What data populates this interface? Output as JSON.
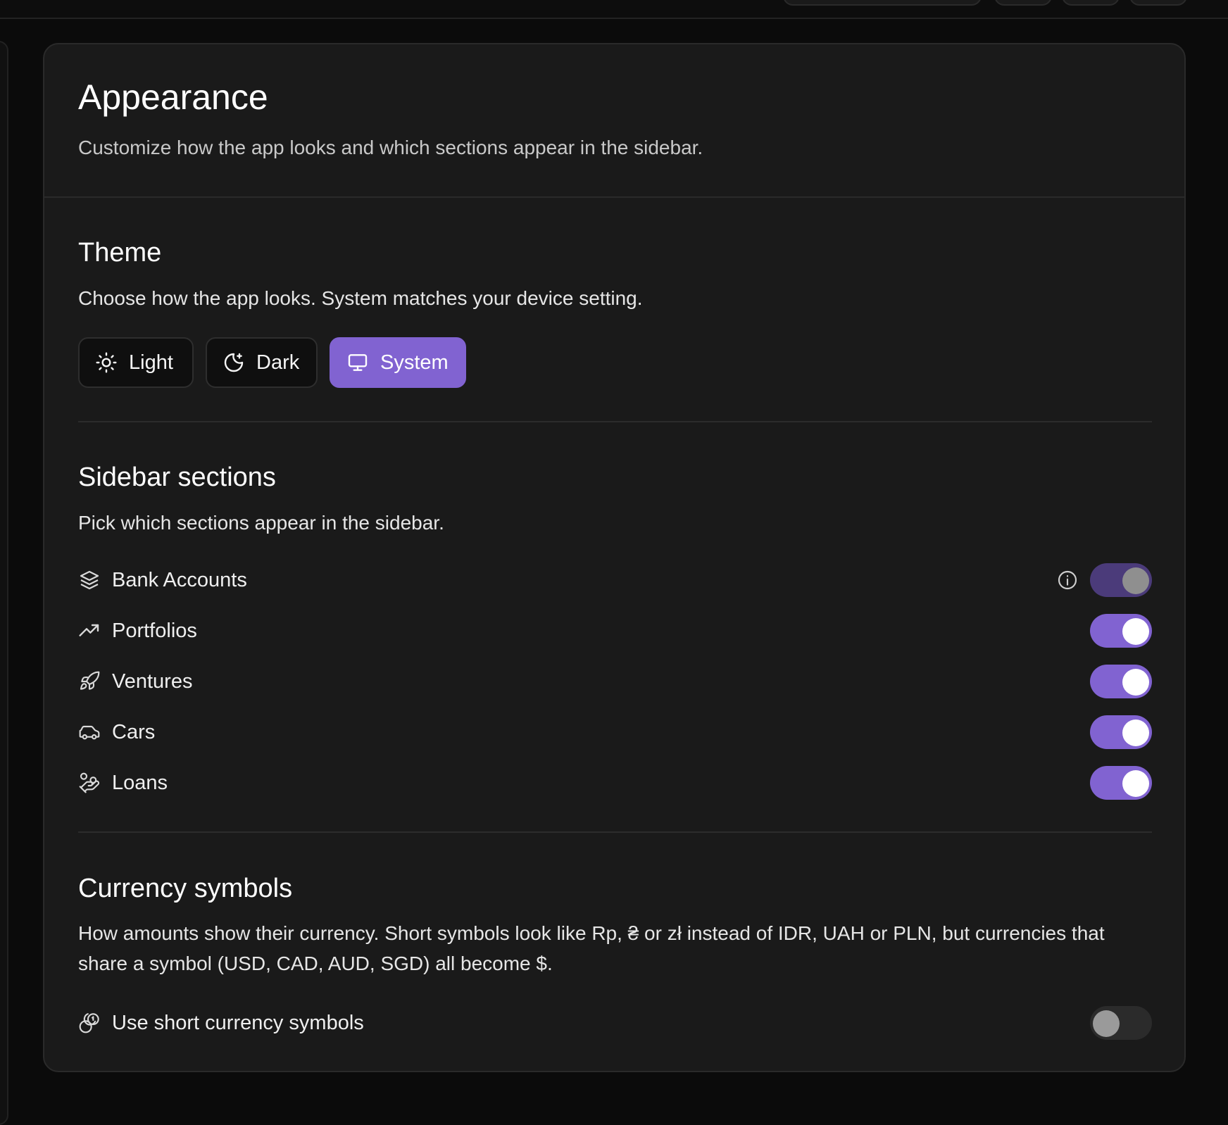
{
  "appearance": {
    "title": "Appearance",
    "subtitle": "Customize how the app looks and which sections appear in the sidebar."
  },
  "theme": {
    "title": "Theme",
    "description": "Choose how the app looks. System matches your device setting.",
    "options": [
      {
        "label": "Light",
        "icon": "sun-icon",
        "selected": false
      },
      {
        "label": "Dark",
        "icon": "moon-icon",
        "selected": false
      },
      {
        "label": "System",
        "icon": "monitor-icon",
        "selected": true
      }
    ]
  },
  "sidebar_sections": {
    "title": "Sidebar sections",
    "description": "Pick which sections appear in the sidebar.",
    "items": [
      {
        "label": "Bank Accounts",
        "icon": "layers-icon",
        "enabled": true,
        "locked": true,
        "has_info": true
      },
      {
        "label": "Portfolios",
        "icon": "trending-up-icon",
        "enabled": true
      },
      {
        "label": "Ventures",
        "icon": "rocket-icon",
        "enabled": true
      },
      {
        "label": "Cars",
        "icon": "car-icon",
        "enabled": true
      },
      {
        "label": "Loans",
        "icon": "hand-coins-icon",
        "enabled": true
      }
    ]
  },
  "currency": {
    "title": "Currency symbols",
    "description": "How amounts show their currency. Short symbols look like Rp, ₴ or zł instead of IDR, UAH or PLN, but currencies that share a symbol (USD, CAD, AUD, SGD) all become $.",
    "option_label": "Use short currency symbols",
    "option_icon": "coins-icon",
    "enabled": false
  },
  "colors": {
    "accent": "#8163d1",
    "card_bg": "#1a1a1a",
    "page_bg": "#0b0b0b"
  }
}
